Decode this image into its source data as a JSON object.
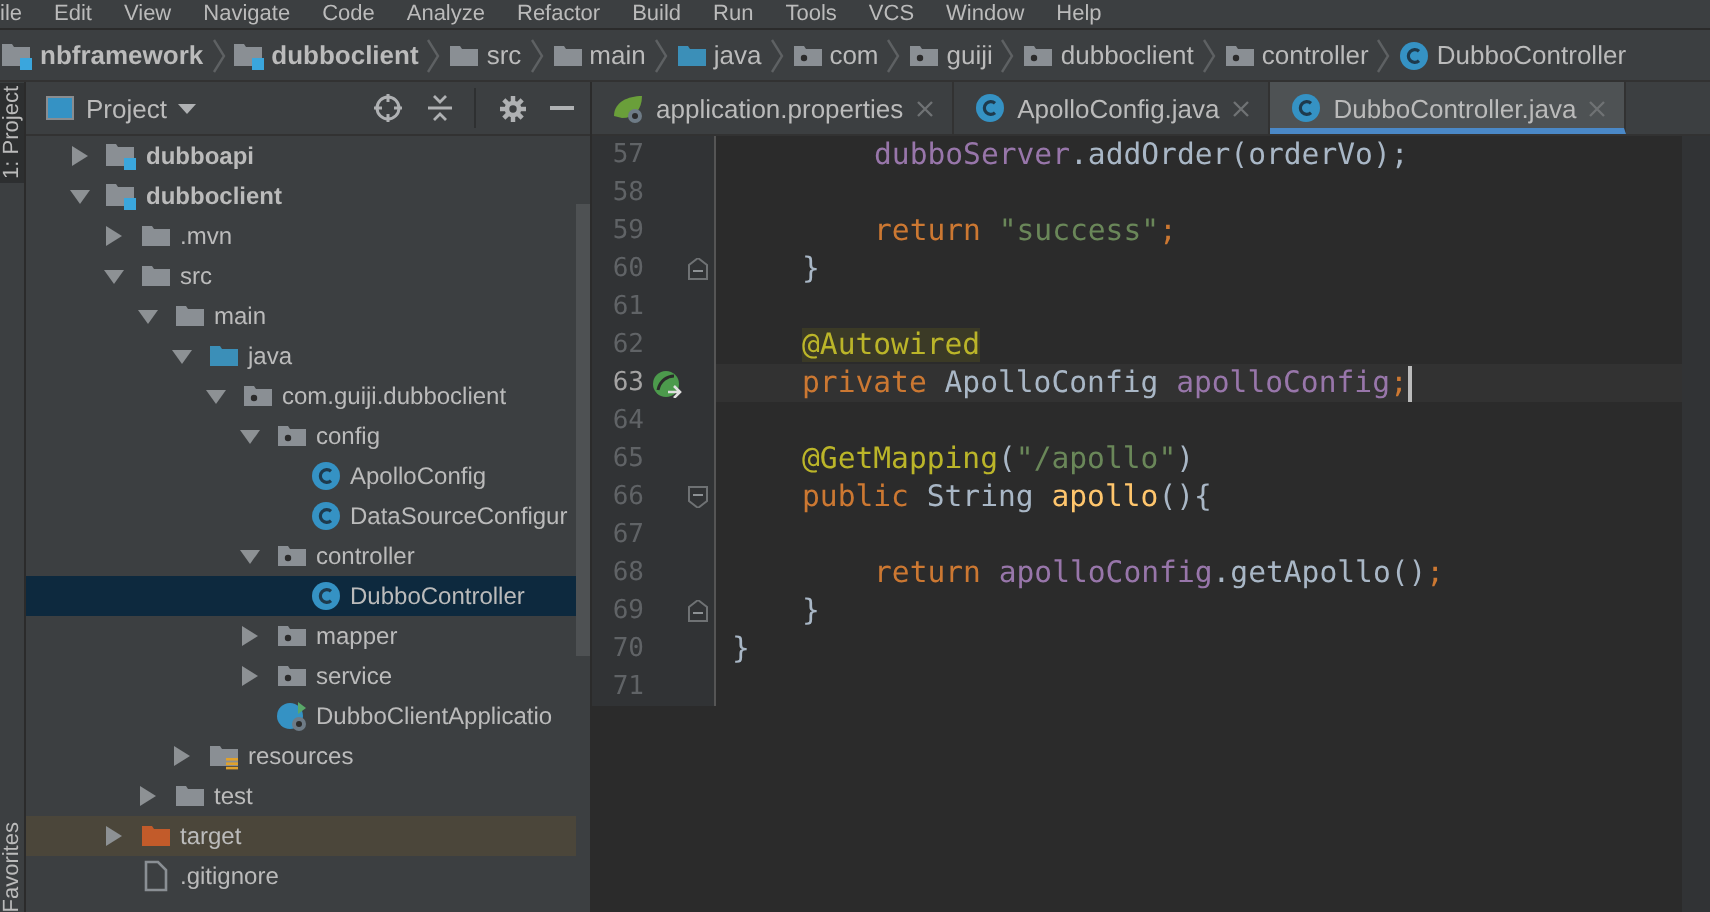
{
  "menu_bar": [
    "ile",
    "Edit",
    "View",
    "Navigate",
    "Code",
    "Analyze",
    "Refactor",
    "Build",
    "Run",
    "Tools",
    "VCS",
    "Window",
    "Help"
  ],
  "breadcrumbs": [
    {
      "label": "nbframework",
      "kind": "module"
    },
    {
      "label": "dubboclient",
      "kind": "module"
    },
    {
      "label": "src",
      "kind": "folder"
    },
    {
      "label": "main",
      "kind": "folder"
    },
    {
      "label": "java",
      "kind": "source-root"
    },
    {
      "label": "com",
      "kind": "package"
    },
    {
      "label": "guiji",
      "kind": "package"
    },
    {
      "label": "dubboclient",
      "kind": "package"
    },
    {
      "label": "controller",
      "kind": "package"
    },
    {
      "label": "DubboController",
      "kind": "class"
    }
  ],
  "side_strip": {
    "top_tab": "1: Project",
    "bottom_tab": "Favorites"
  },
  "project_panel": {
    "title": "Project",
    "tree": [
      {
        "label": "dubboapi",
        "kind": "module",
        "expanded": false,
        "selected": false,
        "highlighted": false
      },
      {
        "label": "dubboclient",
        "kind": "module",
        "expanded": true,
        "selected": false,
        "highlighted": false,
        "children": [
          {
            "label": ".mvn",
            "kind": "folder",
            "expanded": false,
            "selected": false,
            "highlighted": false
          },
          {
            "label": "src",
            "kind": "folder",
            "expanded": true,
            "selected": false,
            "highlighted": false,
            "children": [
              {
                "label": "main",
                "kind": "folder",
                "expanded": true,
                "selected": false,
                "highlighted": false,
                "children": [
                  {
                    "label": "java",
                    "kind": "source-root",
                    "expanded": true,
                    "selected": false,
                    "highlighted": false,
                    "children": [
                      {
                        "label": "com.guiji.dubboclient",
                        "kind": "package",
                        "expanded": true,
                        "selected": false,
                        "highlighted": false,
                        "children": [
                          {
                            "label": "config",
                            "kind": "package",
                            "expanded": true,
                            "selected": false,
                            "highlighted": false,
                            "children": [
                              {
                                "label": "ApolloConfig",
                                "kind": "class",
                                "selected": false,
                                "highlighted": false
                              },
                              {
                                "label": "DataSourceConfigur",
                                "kind": "class",
                                "selected": false,
                                "highlighted": false
                              }
                            ]
                          },
                          {
                            "label": "controller",
                            "kind": "package",
                            "expanded": true,
                            "selected": false,
                            "highlighted": false,
                            "children": [
                              {
                                "label": "DubboController",
                                "kind": "class",
                                "selected": true,
                                "highlighted": false
                              }
                            ]
                          },
                          {
                            "label": "mapper",
                            "kind": "package",
                            "expanded": false,
                            "selected": false,
                            "highlighted": false
                          },
                          {
                            "label": "service",
                            "kind": "package",
                            "expanded": false,
                            "selected": false,
                            "highlighted": false
                          },
                          {
                            "label": "DubboClientApplicatio",
                            "kind": "spring-class",
                            "selected": false,
                            "highlighted": false
                          }
                        ]
                      }
                    ]
                  },
                  {
                    "label": "resources",
                    "kind": "resources-root",
                    "expanded": false,
                    "selected": false,
                    "highlighted": false
                  }
                ]
              },
              {
                "label": "test",
                "kind": "folder",
                "expanded": false,
                "selected": false,
                "highlighted": false
              }
            ]
          },
          {
            "label": "target",
            "kind": "excluded",
            "expanded": false,
            "selected": false,
            "highlighted": true
          },
          {
            "label": ".gitignore",
            "kind": "file",
            "selected": false,
            "highlighted": false
          }
        ]
      }
    ]
  },
  "editor_tabs": [
    {
      "label": "application.properties",
      "kind": "spring",
      "selected": false
    },
    {
      "label": "ApolloConfig.java",
      "kind": "class",
      "selected": false
    },
    {
      "label": "DubboController.java",
      "kind": "class",
      "selected": true
    }
  ],
  "code_lines": [
    {
      "number": "57",
      "kind": "method-body",
      "current": false,
      "fold_start": false,
      "fold_end": false,
      "bean_icon": false,
      "tokens": [
        {
          "text": "dubboServer",
          "kind": "field"
        },
        {
          "text": ".addOrder(orderVo);",
          "kind": "plain"
        }
      ]
    },
    {
      "number": "58",
      "kind": "method-body",
      "current": false,
      "fold_start": false,
      "fold_end": false,
      "bean_icon": false
    },
    {
      "number": "59",
      "kind": "method-body",
      "current": false,
      "fold_start": false,
      "fold_end": false,
      "bean_icon": false,
      "tokens": [
        {
          "text": "return",
          "kind": "keyword"
        },
        {
          "text": " \"success\"",
          "kind": "string"
        },
        {
          "text": ";",
          "kind": "keyword"
        }
      ]
    },
    {
      "number": "60",
      "kind": "class-body",
      "current": false,
      "fold_start": false,
      "fold_end": true,
      "bean_icon": false,
      "tokens": [
        {
          "text": "}",
          "kind": "plain"
        }
      ]
    },
    {
      "number": "61",
      "kind": "class-body",
      "current": false,
      "fold_start": false,
      "fold_end": false,
      "bean_icon": false
    },
    {
      "number": "62",
      "kind": "class-body",
      "current": false,
      "fold_start": false,
      "fold_end": false,
      "bean_icon": false,
      "tokens": [
        {
          "text": "@Autowired",
          "kind": "annotation-highlight"
        }
      ]
    },
    {
      "number": "63",
      "kind": "class-body",
      "current": true,
      "fold_start": false,
      "fold_end": false,
      "bean_icon": true,
      "tokens": [
        {
          "text": "private",
          "kind": "keyword"
        },
        {
          "text": " ApolloConfig ",
          "kind": "plain"
        },
        {
          "text": "apolloConfig",
          "kind": "field"
        },
        {
          "text": ";",
          "kind": "keyword"
        }
      ]
    },
    {
      "number": "64",
      "kind": "class-body",
      "current": false,
      "fold_start": false,
      "fold_end": false,
      "bean_icon": false
    },
    {
      "number": "65",
      "kind": "class-body",
      "current": false,
      "fold_start": false,
      "fold_end": false,
      "bean_icon": false,
      "tokens": [
        {
          "text": "@GetMapping",
          "kind": "annotation"
        },
        {
          "text": "(",
          "kind": "plain"
        },
        {
          "text": "\"/apollo\"",
          "kind": "string"
        },
        {
          "text": ")",
          "kind": "plain"
        }
      ]
    },
    {
      "number": "66",
      "kind": "class-body",
      "current": false,
      "fold_start": true,
      "fold_end": false,
      "bean_icon": false,
      "tokens": [
        {
          "text": "public",
          "kind": "keyword"
        },
        {
          "text": " String ",
          "kind": "plain"
        },
        {
          "text": "apollo",
          "kind": "method"
        },
        {
          "text": "(){",
          "kind": "plain"
        }
      ]
    },
    {
      "number": "67",
      "kind": "method-body",
      "current": false,
      "fold_start": false,
      "fold_end": false,
      "bean_icon": false
    },
    {
      "number": "68",
      "kind": "method-body",
      "current": false,
      "fold_start": false,
      "fold_end": false,
      "bean_icon": false,
      "tokens": [
        {
          "text": "return",
          "kind": "keyword"
        },
        {
          "text": " apolloConfig",
          "kind": "field"
        },
        {
          "text": ".getApollo()",
          "kind": "plain"
        },
        {
          "text": ";",
          "kind": "keyword"
        }
      ]
    },
    {
      "number": "69",
      "kind": "class-body",
      "current": false,
      "fold_start": false,
      "fold_end": true,
      "bean_icon": false,
      "tokens": [
        {
          "text": "}",
          "kind": "plain"
        }
      ]
    },
    {
      "number": "70",
      "kind": "top-level",
      "current": false,
      "fold_start": false,
      "fold_end": false,
      "bean_icon": false,
      "tokens": [
        {
          "text": "}",
          "kind": "plain"
        }
      ]
    },
    {
      "number": "71",
      "kind": "top-level",
      "current": false,
      "fold_start": false,
      "fold_end": false,
      "bean_icon": false
    }
  ]
}
